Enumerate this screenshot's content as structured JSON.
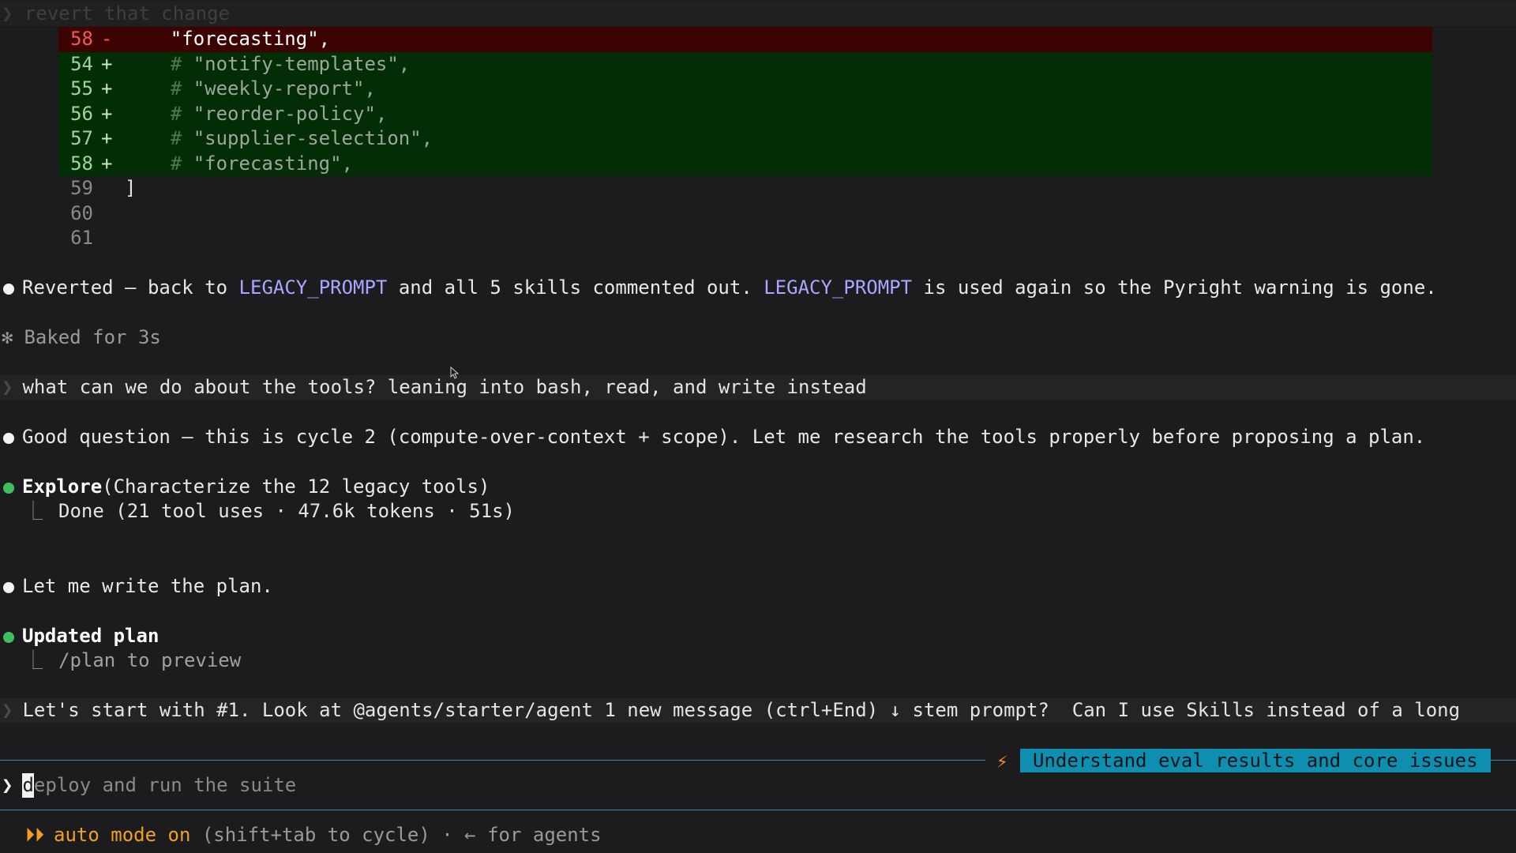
{
  "previous_prompt": {
    "chevron": "❯",
    "text": "revert that change"
  },
  "diff": {
    "removed": [
      {
        "num": "58",
        "sign": "-",
        "code": "    \"forecasting\","
      }
    ],
    "added": [
      {
        "num": "54",
        "sign": "+",
        "hash": "#",
        "code": " \"notify-templates\","
      },
      {
        "num": "55",
        "sign": "+",
        "hash": "#",
        "code": " \"weekly-report\","
      },
      {
        "num": "56",
        "sign": "+",
        "hash": "#",
        "code": " \"reorder-policy\","
      },
      {
        "num": "57",
        "sign": "+",
        "hash": "#",
        "code": " \"supplier-selection\","
      },
      {
        "num": "58",
        "sign": "+",
        "hash": "#",
        "code": " \"forecasting\","
      }
    ],
    "context": [
      {
        "num": "59",
        "code": "]"
      },
      {
        "num": "60",
        "code": ""
      },
      {
        "num": "61",
        "code": ""
      }
    ]
  },
  "messages": {
    "reverted": {
      "part1": "Reverted — back to ",
      "ref1": "LEGACY_PROMPT",
      "part2": " and all 5 skills commented out. ",
      "ref2": "LEGACY_PROMPT",
      "part3": " is used again so the Pyright warning is gone."
    },
    "baked": {
      "icon": "✻",
      "text": "Baked for 3s"
    },
    "user_question": {
      "chevron": "❯",
      "text": "what can we do about the tools? leaning into bash, read, and write instead"
    },
    "good_question": "Good question — this is cycle 2 (compute-over-context + scope). Let me research the tools properly before proposing a plan.",
    "explore": {
      "title": "Explore",
      "args": "(Characterize the 12 legacy tools)",
      "elbow": "⎿",
      "result": "Done (21 tool uses · 47.6k tokens · 51s)"
    },
    "write_plan": "Let me write the plan.",
    "updated_plan": {
      "title": "Updated plan",
      "elbow": "⎿",
      "hint": "/plan to preview"
    },
    "user_followup": {
      "chevron": "❯",
      "text": "Let's start with #1. Look at @agents/starter/agent 1 new message (ctrl+End) ↓ stem prompt?  Can I use Skills instead of a long"
    }
  },
  "task_badge": {
    "icon": "⚡",
    "label": "Understand eval results and core issues"
  },
  "input": {
    "chevron": "❯",
    "cursor_char": "d",
    "placeholder_rest": "eploy and run the suite"
  },
  "status": {
    "icon": "⏵⏵",
    "mode": "auto mode on",
    "hint": " (shift+tab to cycle) · ← for agents"
  },
  "colors": {
    "background": "#1c1c1e",
    "removed_bg": "#3d0303",
    "added_bg": "#032d05",
    "code_ref": "#a9a6ff",
    "success": "#3fbf5c",
    "accent": "#0e8fb0",
    "auto_mode": "#f0a020"
  }
}
